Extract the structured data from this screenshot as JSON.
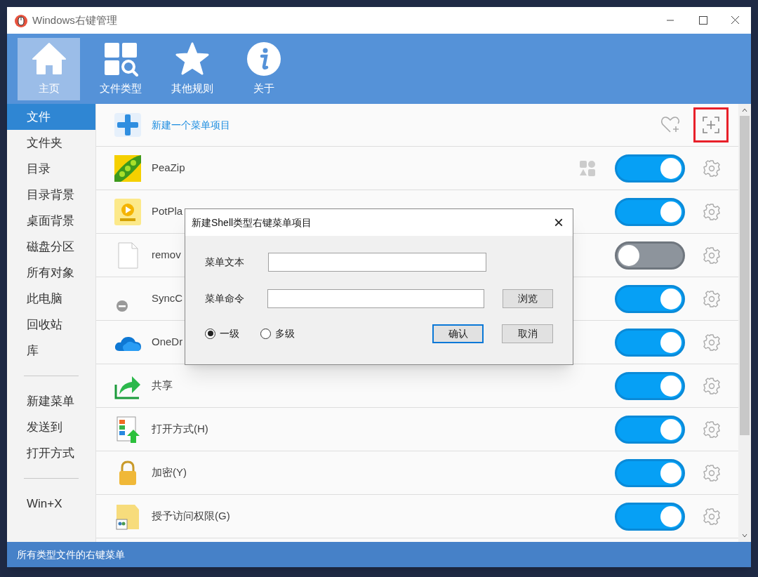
{
  "window": {
    "title": "Windows右键管理"
  },
  "toolbar": {
    "tabs": [
      {
        "label": "主页",
        "kind": "home",
        "selected": true
      },
      {
        "label": "文件类型",
        "kind": "filetypes",
        "selected": false
      },
      {
        "label": "其他规则",
        "kind": "rules",
        "selected": false
      },
      {
        "label": "关于",
        "kind": "about",
        "selected": false
      }
    ]
  },
  "sidebar": {
    "groups": [
      {
        "items": [
          {
            "label": "文件",
            "selected": true
          },
          {
            "label": "文件夹",
            "selected": false
          },
          {
            "label": "目录",
            "selected": false
          },
          {
            "label": "目录背景",
            "selected": false
          },
          {
            "label": "桌面背景",
            "selected": false
          },
          {
            "label": "磁盘分区",
            "selected": false
          },
          {
            "label": "所有对象",
            "selected": false
          },
          {
            "label": "此电脑",
            "selected": false
          },
          {
            "label": "回收站",
            "selected": false
          },
          {
            "label": "库",
            "selected": false
          }
        ]
      },
      {
        "items": [
          {
            "label": "新建菜单",
            "selected": false
          },
          {
            "label": "发送到",
            "selected": false
          },
          {
            "label": "打开方式",
            "selected": false
          }
        ]
      },
      {
        "items": [
          {
            "label": "Win+X",
            "selected": false
          }
        ]
      }
    ]
  },
  "list": {
    "new_item": {
      "label": "新建一个菜单项目"
    },
    "rows": [
      {
        "label": "PeaZip",
        "kind": "peazip",
        "on": true,
        "shapes_icon": true
      },
      {
        "label": "PotPla",
        "kind": "player",
        "on": true,
        "shapes_icon": false
      },
      {
        "label": "remov",
        "kind": "file",
        "on": false,
        "shapes_icon": false
      },
      {
        "label": "SyncC",
        "kind": "minus",
        "on": true,
        "shapes_icon": false
      },
      {
        "label": "OneDr",
        "kind": "cloud",
        "on": true,
        "shapes_icon": false
      },
      {
        "label": "共享",
        "kind": "share",
        "on": true,
        "shapes_icon": false
      },
      {
        "label": "打开方式(H)",
        "kind": "openwith",
        "on": true,
        "shapes_icon": false
      },
      {
        "label": "加密(Y)",
        "kind": "lock",
        "on": true,
        "shapes_icon": false
      },
      {
        "label": "授予访问权限(G)",
        "kind": "folder",
        "on": true,
        "shapes_icon": false
      }
    ]
  },
  "status_bar": {
    "text": "所有类型文件的右键菜单"
  },
  "dialog": {
    "title": "新建Shell类型右键菜单项目",
    "close": "×",
    "fields": [
      {
        "label": "菜单文本"
      },
      {
        "label": "菜单命令",
        "button": "浏览"
      }
    ],
    "radios": [
      {
        "label": "一级",
        "selected": true
      },
      {
        "label": "多级",
        "selected": false
      }
    ],
    "buttons": [
      {
        "label": "确认",
        "default": true
      },
      {
        "label": "取消",
        "default": false
      }
    ]
  }
}
